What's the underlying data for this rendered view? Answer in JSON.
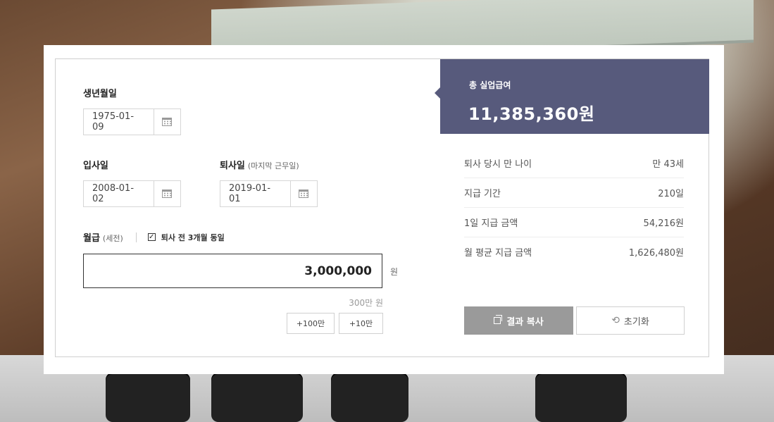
{
  "birth": {
    "label": "생년월일",
    "value": "1975-01-09"
  },
  "join": {
    "label": "입사일",
    "value": "2008-01-02"
  },
  "leave": {
    "label": "퇴사일",
    "sublabel": "(마지막 근무일)",
    "value": "2019-01-01"
  },
  "salary": {
    "label": "월급",
    "sublabel": "(세전)",
    "checkbox_label": "퇴사 전 3개월 동일",
    "checkbox_checked": true,
    "value": "3,000,000",
    "unit": "원",
    "hint": "300만 원",
    "buttons": [
      "+100만",
      "+10만"
    ]
  },
  "result": {
    "title": "총 실업급여",
    "amount": "11,385,360원",
    "rows": [
      {
        "label": "퇴사 당시 만 나이",
        "value": "만 43세"
      },
      {
        "label": "지급 기간",
        "value": "210일"
      },
      {
        "label": "1일 지급 금액",
        "value": "54,216원"
      },
      {
        "label": "월 평균 지급 금액",
        "value": "1,626,480원"
      }
    ],
    "copy_button": "결과 복사",
    "reset_button": "초기화"
  },
  "colors": {
    "header": "#575a7c",
    "copy_button": "#9a9a9a"
  }
}
